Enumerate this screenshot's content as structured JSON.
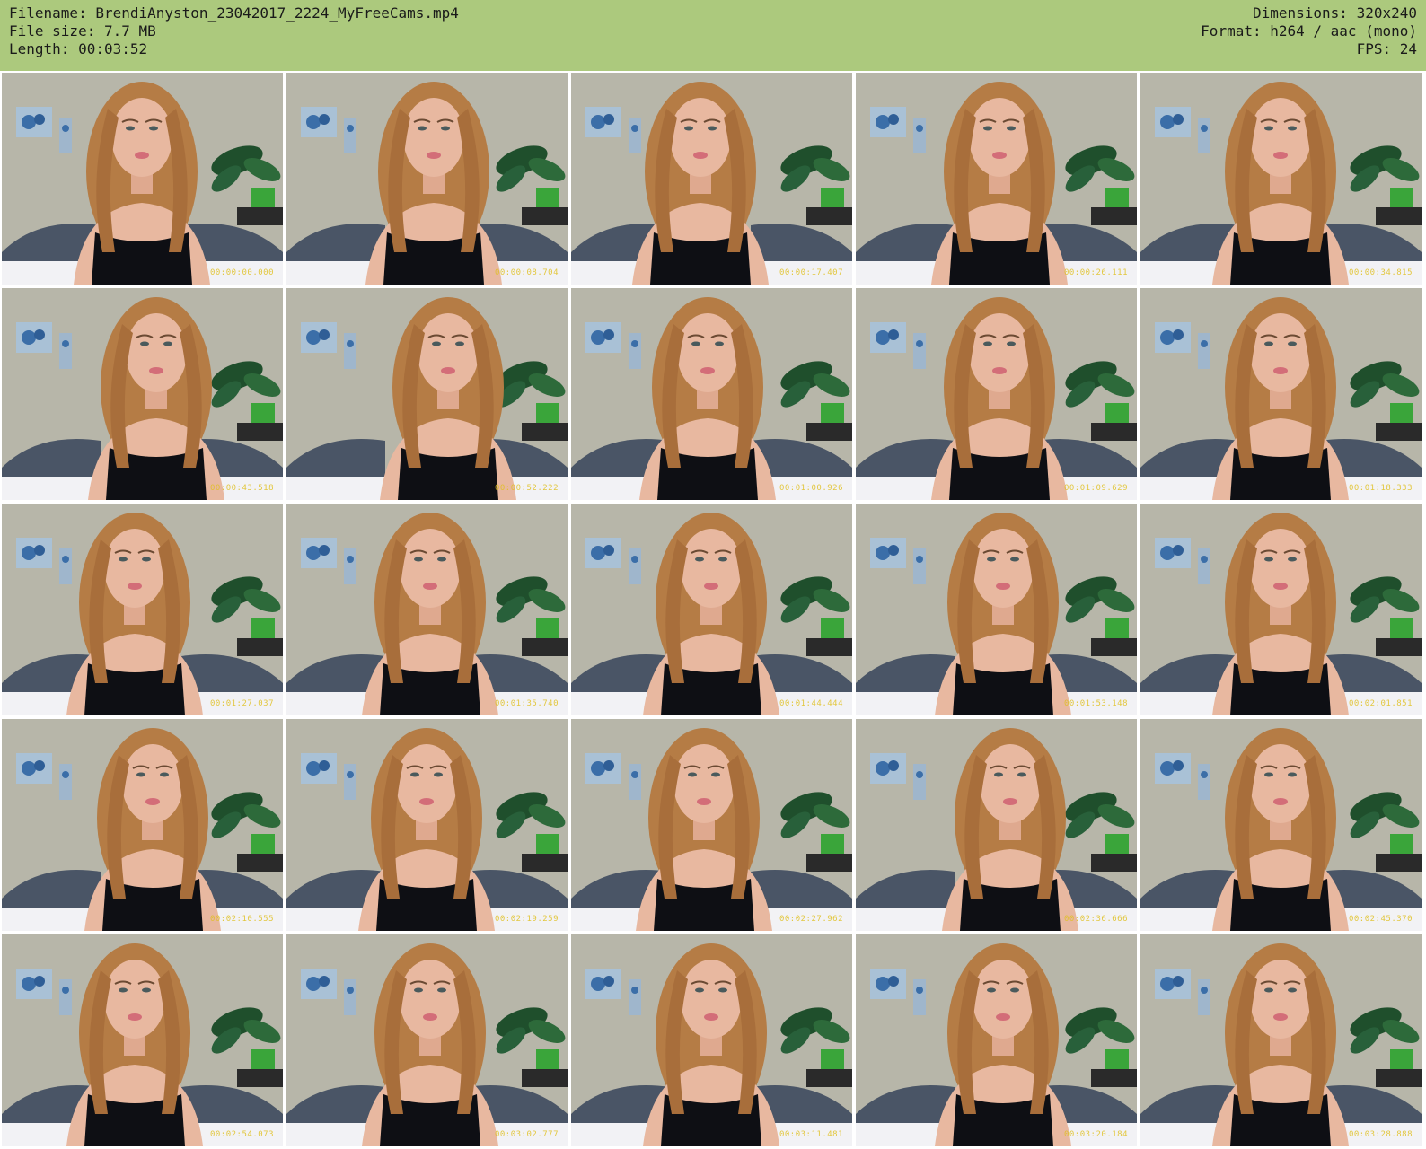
{
  "header": {
    "filename_line": "Filename: BrendiAnyston_23042017_2224_MyFreeCams.mp4",
    "filesize_line": "File size: 7.7 MB",
    "length_line": "Length: 00:03:52",
    "dimensions_line": "Dimensions: 320x240",
    "format_line": "Format: h264 / aac (mono)",
    "fps_line": "FPS: 24"
  },
  "colors": {
    "header_bg": "#acc97d",
    "wall": "#b7b6a9",
    "hair": "#b57c45",
    "skin": "#e8b8a0",
    "top": "#0e0f14",
    "pot": "#3aa53a",
    "plant": "#1f4f2c",
    "bedding": "#f2f2f5",
    "timestamp": "#e0c020"
  },
  "thumbnails": [
    {
      "timestamp": "00:00:00.000"
    },
    {
      "timestamp": "00:00:08.704"
    },
    {
      "timestamp": "00:00:17.407"
    },
    {
      "timestamp": "00:00:26.111"
    },
    {
      "timestamp": "00:00:34.815"
    },
    {
      "timestamp": "00:00:43.518"
    },
    {
      "timestamp": "00:00:52.222"
    },
    {
      "timestamp": "00:01:00.926"
    },
    {
      "timestamp": "00:01:09.629"
    },
    {
      "timestamp": "00:01:18.333"
    },
    {
      "timestamp": "00:01:27.037"
    },
    {
      "timestamp": "00:01:35.740"
    },
    {
      "timestamp": "00:01:44.444"
    },
    {
      "timestamp": "00:01:53.148"
    },
    {
      "timestamp": "00:02:01.851"
    },
    {
      "timestamp": "00:02:10.555"
    },
    {
      "timestamp": "00:02:19.259"
    },
    {
      "timestamp": "00:02:27.962"
    },
    {
      "timestamp": "00:02:36.666"
    },
    {
      "timestamp": "00:02:45.370"
    },
    {
      "timestamp": "00:02:54.073"
    },
    {
      "timestamp": "00:03:02.777"
    },
    {
      "timestamp": "00:03:11.481"
    },
    {
      "timestamp": "00:03:20.184"
    },
    {
      "timestamp": "00:03:28.888"
    }
  ]
}
